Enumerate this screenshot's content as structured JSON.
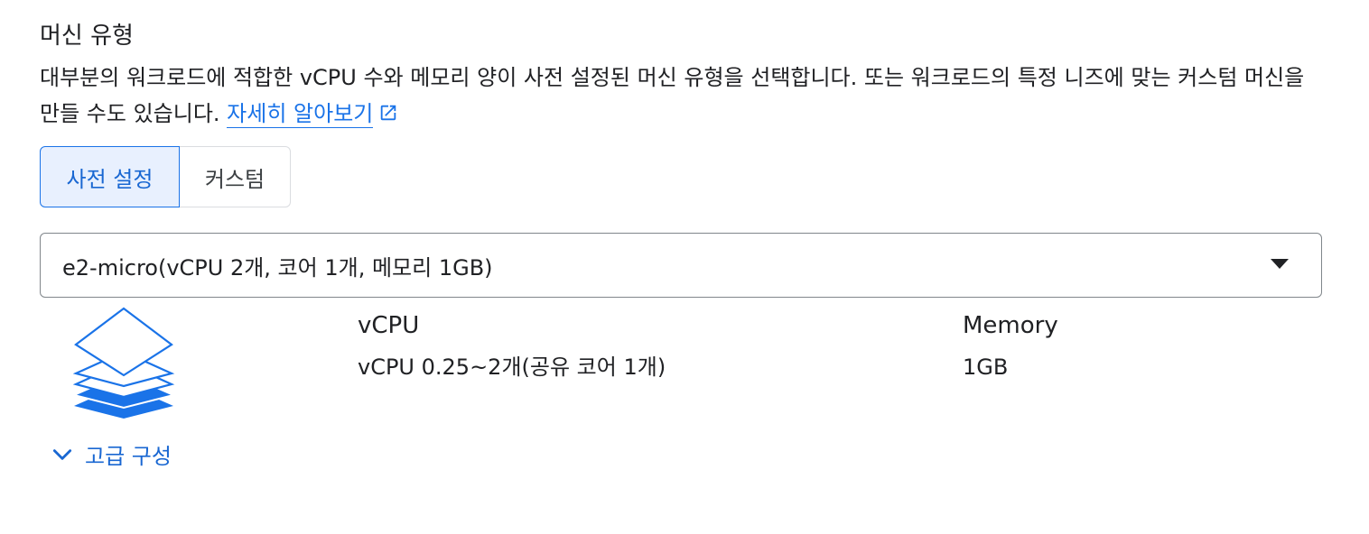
{
  "section": {
    "title": "머신 유형",
    "description": "대부분의 워크로드에 적합한 vCPU 수와 메모리 양이 사전 설정된 머신 유형을 선택합니다. 또는 워크로드의 특정 니즈에 맞는 커스텀 머신을 만들 수도 있습니다.",
    "learn_more": "자세히 알아보기"
  },
  "toggle": {
    "options": [
      "사전 설정",
      "커스텀"
    ],
    "selected": "사전 설정"
  },
  "machine_select": {
    "value": "e2-micro(vCPU 2개, 코어 1개, 메모리 1GB)"
  },
  "specs": {
    "vcpu_label": "vCPU",
    "vcpu_value": "vCPU 0.25~2개(공유 코어 1개)",
    "memory_label": "Memory",
    "memory_value": "1GB"
  },
  "advanced": {
    "label": "고급 구성"
  },
  "colors": {
    "accent": "#1a73e8",
    "selected_bg": "#e8f0fe"
  }
}
